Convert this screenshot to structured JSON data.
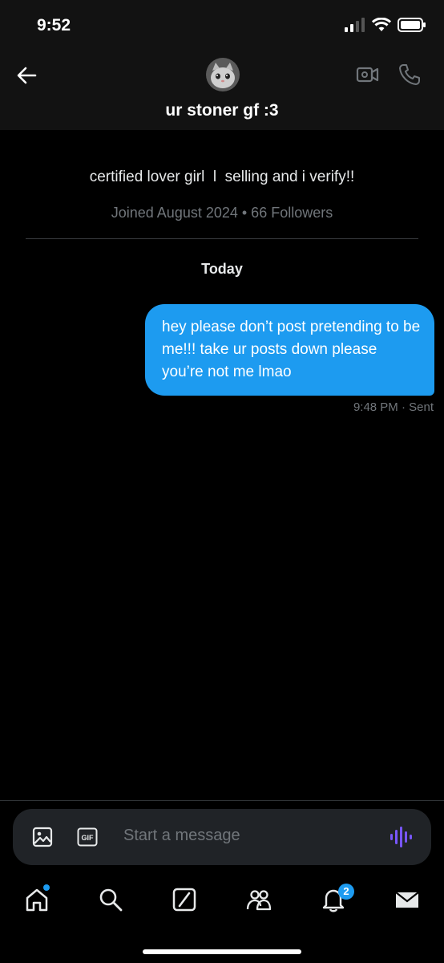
{
  "status_bar": {
    "time": "9:52"
  },
  "conversation": {
    "title": "ur stoner gf :3",
    "bio": "certified lover girl  l  selling and i verify!!",
    "joined": "Joined August 2024 • 66 Followers",
    "date_separator": "Today"
  },
  "messages": [
    {
      "text": "hey please don’t post pretending to be me!!! take ur posts down please you’re not me lmao",
      "time": "9:48 PM",
      "status": "Sent",
      "meta": "9:48 PM · Sent"
    }
  ],
  "composer": {
    "placeholder": "Start a message"
  },
  "tabbar": {
    "notifications_badge": "2"
  },
  "colors": {
    "accent": "#1d9bf0",
    "voice": "#7856ff",
    "background": "#000000"
  },
  "icons": [
    "back-arrow-icon",
    "video-call-icon",
    "phone-icon",
    "image-icon",
    "gif-icon",
    "voice-icon",
    "home-icon",
    "search-icon",
    "grok-icon",
    "communities-icon",
    "bell-icon",
    "mail-icon"
  ]
}
